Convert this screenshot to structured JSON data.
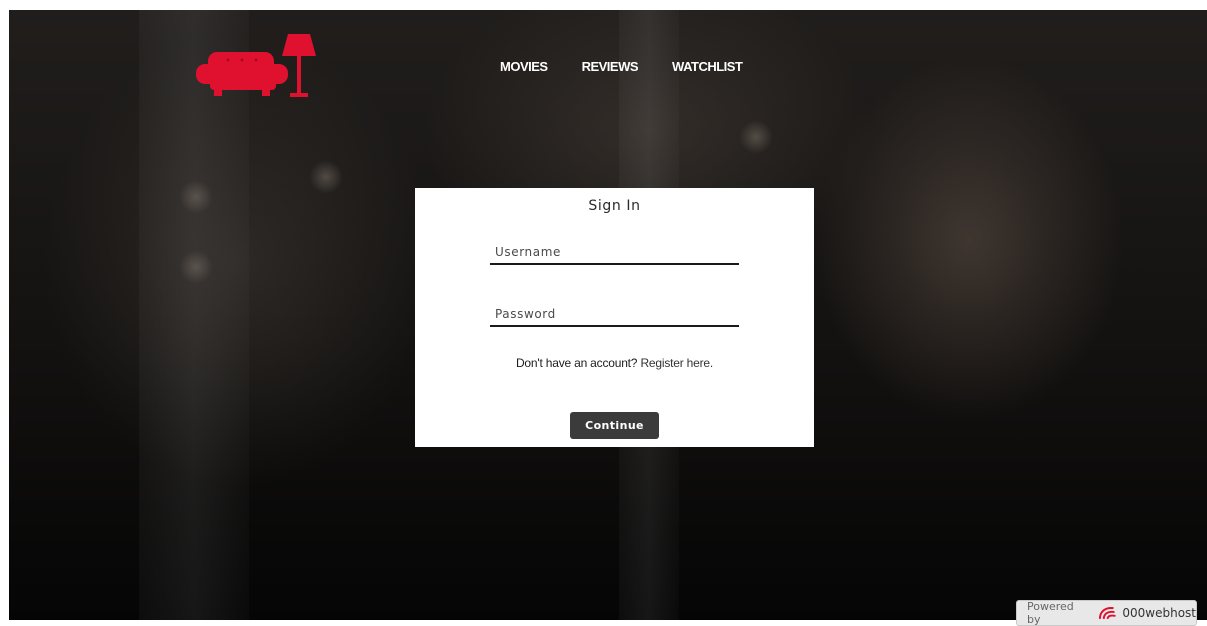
{
  "nav": {
    "items": [
      {
        "label": "MOVIES"
      },
      {
        "label": "REVIEWS"
      },
      {
        "label": "WATCHLIST"
      }
    ]
  },
  "login": {
    "title": "Sign In",
    "username_placeholder": "Username",
    "password_placeholder": "Password",
    "register_prompt": "Don't have an account?",
    "register_link": "Register here.",
    "continue_label": "Continue"
  },
  "footer": {
    "powered_prefix": "Powered by",
    "powered_brand": "000webhost"
  },
  "icons": {
    "logo": "sofa-lamp-icon",
    "host_logo": "webhost-swirl-icon"
  },
  "colors": {
    "brand_red": "#e0102f",
    "button_bg": "#3b3b3b",
    "card_bg": "#ffffff"
  }
}
